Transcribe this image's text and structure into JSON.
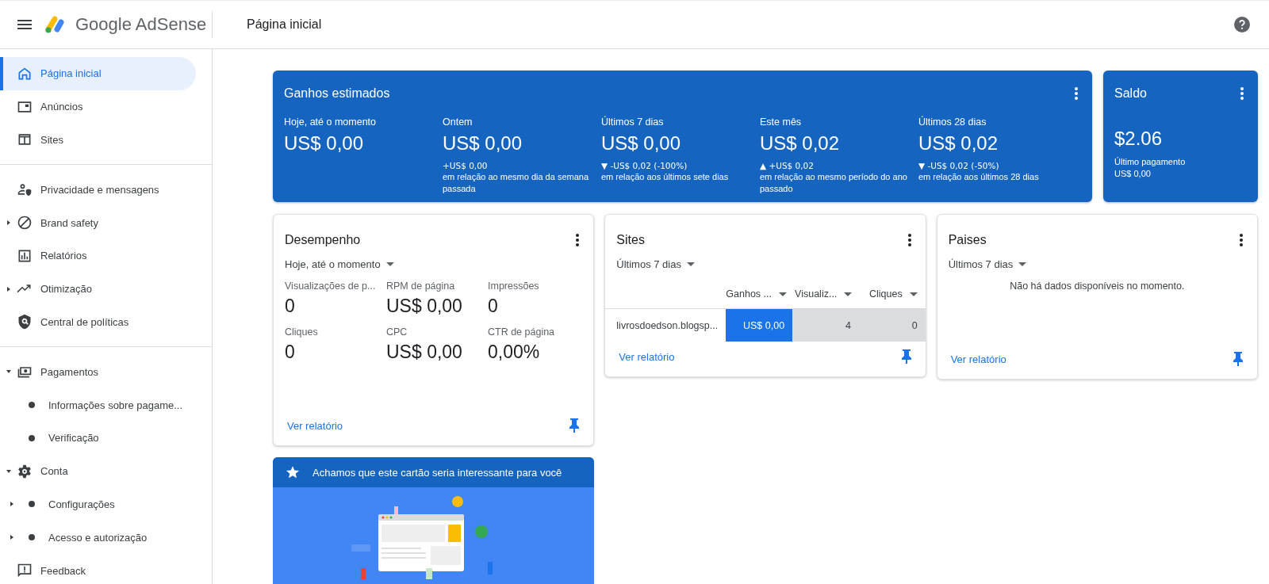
{
  "header": {
    "product": "Google AdSense",
    "page_title": "Página inicial"
  },
  "sidebar": {
    "sections": [
      {
        "items": [
          {
            "label": "Página inicial",
            "selected": true
          },
          {
            "label": "Anúncios",
            "selected": false
          },
          {
            "label": "Sites",
            "selected": false
          }
        ]
      },
      {
        "items": [
          {
            "label": "Privacidade e mensagens",
            "selected": false
          },
          {
            "label": "Brand safety",
            "selected": false,
            "expanded": false
          },
          {
            "label": "Relatórios",
            "selected": false
          },
          {
            "label": "Otimização",
            "selected": false,
            "expanded": false
          },
          {
            "label": "Central de políticas",
            "selected": false
          }
        ]
      },
      {
        "items": [
          {
            "label": "Pagamentos",
            "selected": false,
            "expanded": true,
            "children": [
              {
                "label": "Informações sobre pagame...",
                "selected": false
              },
              {
                "label": "Verificação",
                "selected": false
              }
            ]
          },
          {
            "label": "Conta",
            "selected": false,
            "expanded": true,
            "children": [
              {
                "label": "Configurações",
                "selected": false,
                "expanded": false
              },
              {
                "label": "Acesso e autorização",
                "selected": false,
                "expanded": false
              }
            ]
          },
          {
            "label": "Feedback",
            "selected": false
          }
        ]
      }
    ]
  },
  "earnings": {
    "title": "Ganhos estimados",
    "metrics": [
      {
        "label": "Hoje, até o momento",
        "value": "US$ 0,00"
      },
      {
        "label": "Ontem",
        "value": "US$ 0,00",
        "change": "+US$ 0,00",
        "comparison": "em relação ao mesmo dia da semana passada"
      },
      {
        "label": "Últimos 7 dias",
        "value": "US$ 0,00",
        "change": "▼ -US$ 0,02 (-100%)",
        "comparison": "em relação aos últimos sete dias"
      },
      {
        "label": "Este mês",
        "value": "US$ 0,02",
        "change": "▲ +US$ 0,02",
        "comparison": "em relação ao mesmo período do ano passado"
      },
      {
        "label": "Últimos 28 dias",
        "value": "US$ 0,02",
        "change": "▼ -US$ 0,02 (-50%)",
        "comparison": "em relação aos últimos 28 dias"
      }
    ]
  },
  "balance": {
    "title": "Saldo",
    "amount": "$2.06",
    "last_payment_label": "Último pagamento",
    "last_payment_value": "US$ 0,00"
  },
  "performance": {
    "title": "Desempenho",
    "period": "Hoje, até o momento",
    "metrics": [
      {
        "label": "Visualizações de p...",
        "value": "0"
      },
      {
        "label": "RPM de página",
        "value": "US$ 0,00"
      },
      {
        "label": "Impressões",
        "value": "0"
      },
      {
        "label": "Cliques",
        "value": "0"
      },
      {
        "label": "CPC",
        "value": "US$ 0,00"
      },
      {
        "label": "CTR de página",
        "value": "0,00%"
      }
    ],
    "link": "Ver relatório"
  },
  "sites": {
    "title": "Sites",
    "period": "Últimos 7 dias",
    "columns": [
      "Ganhos ...",
      "Visualiz...",
      "Cliques"
    ],
    "rows": [
      {
        "site": "livrosdoedson.blogsp...",
        "cells": [
          {
            "text": "US$ 0,00",
            "color": "#1a73e8"
          },
          {
            "text": "4",
            "color": "#dadce0"
          },
          {
            "text": "0",
            "color": "#dadce0"
          }
        ]
      }
    ],
    "link": "Ver relatório"
  },
  "countries": {
    "title": "Paises",
    "period": "Últimos 7 dias",
    "empty_message": "Não há dados disponíveis no momento.",
    "link": "Ver relatório"
  },
  "recommendation": {
    "title": "Achamos que este cartão seria interessante para você"
  }
}
